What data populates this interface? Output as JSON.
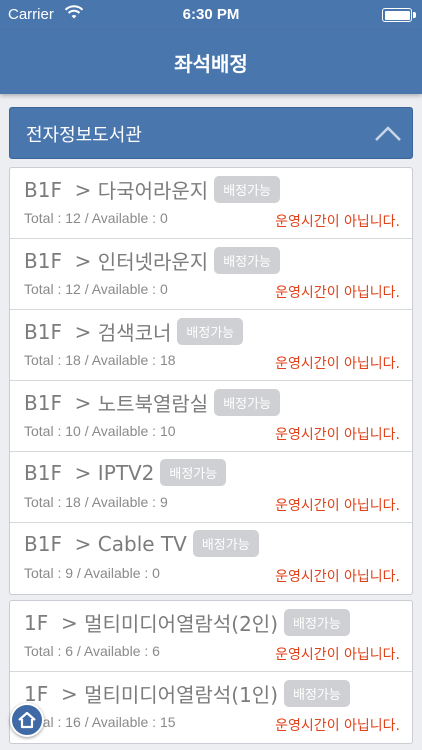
{
  "status_bar": {
    "carrier": "Carrier",
    "time": "6:30 PM"
  },
  "nav": {
    "title": "좌석배정"
  },
  "section": {
    "title": "전자정보도서관"
  },
  "groups": [
    {
      "rows": [
        {
          "floor": "B1F",
          "sep": ">",
          "room": "다국어라운지",
          "badge": "배정가능",
          "counts": "Total : 12 / Available : 0",
          "status": "운영시간이 아닙니다."
        },
        {
          "floor": "B1F",
          "sep": ">",
          "room": "인터넷라운지",
          "badge": "배정가능",
          "counts": "Total : 12 / Available : 0",
          "status": "운영시간이 아닙니다."
        },
        {
          "floor": "B1F",
          "sep": ">",
          "room": "검색코너",
          "badge": "배정가능",
          "counts": "Total : 18 / Available : 18",
          "status": "운영시간이 아닙니다."
        },
        {
          "floor": "B1F",
          "sep": ">",
          "room": "노트북열람실",
          "badge": "배정가능",
          "counts": "Total : 10 / Available : 10",
          "status": "운영시간이 아닙니다."
        },
        {
          "floor": "B1F",
          "sep": ">",
          "room": "IPTV2",
          "badge": "배정가능",
          "counts": "Total : 18 / Available : 9",
          "status": "운영시간이 아닙니다."
        },
        {
          "floor": "B1F",
          "sep": ">",
          "room": "Cable TV",
          "badge": "배정가능",
          "counts": "Total : 9 / Available : 0",
          "status": "운영시간이 아닙니다."
        }
      ]
    },
    {
      "rows": [
        {
          "floor": "1F",
          "sep": ">",
          "room": "멀티미디어열람석(2인)",
          "badge": "배정가능",
          "counts": "Total : 6 / Available : 6",
          "status": "운영시간이 아닙니다."
        },
        {
          "floor": "1F",
          "sep": ">",
          "room": "멀티미디어열람석(1인)",
          "badge": "배정가능",
          "counts": "Total : 16 / Available : 15",
          "status": "운영시간이 아닙니다."
        }
      ]
    }
  ],
  "colors": {
    "primary": "#4a76ae",
    "status": "#e0421a",
    "badge": "#cfd0d3"
  },
  "icons": {
    "wifi": "wifi-icon",
    "battery": "battery-icon",
    "collapse": "chevron-up-icon",
    "home": "home-icon"
  }
}
